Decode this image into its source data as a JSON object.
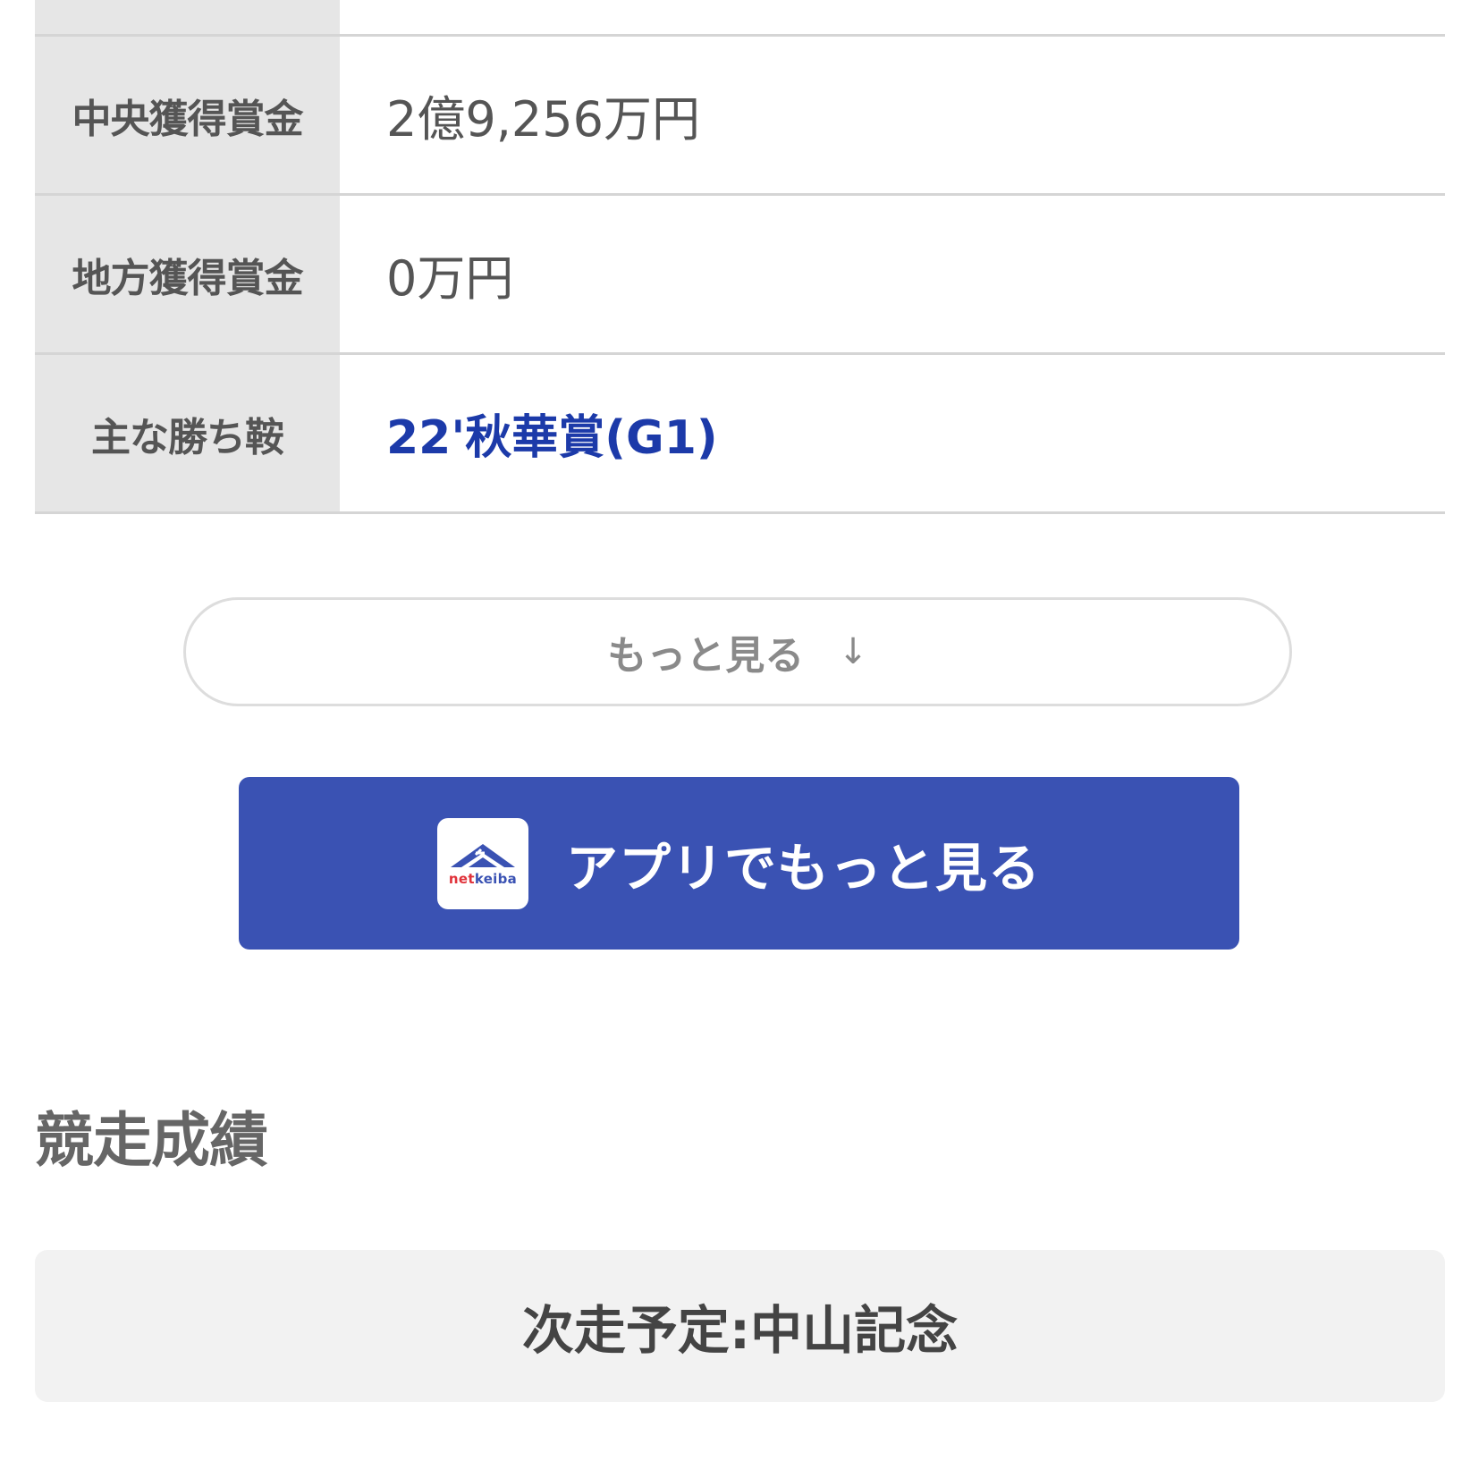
{
  "profile": {
    "rows": [
      {
        "label": "中央獲得賞金",
        "value": "2億9,256万円"
      },
      {
        "label": "地方獲得賞金",
        "value": "0万円"
      },
      {
        "label": "主な勝ち鞍",
        "value": "22'秋華賞(G1)"
      }
    ]
  },
  "more_button": {
    "label": "もっと見る",
    "icon": "arrow-down-icon",
    "arrow": "↓"
  },
  "app_button": {
    "label": "アプリでもっと見る",
    "logo": {
      "net": "net",
      "keiba": "keiba"
    },
    "colors": {
      "background": "#3a52b3",
      "logo_red": "#e0323a"
    }
  },
  "race_results": {
    "title": "競走成績"
  },
  "next_race": {
    "text": "次走予定:中山記念"
  },
  "colors": {
    "link": "#1c3aa9",
    "header_cell": "#e6e6e6",
    "border": "#d5d5d5"
  }
}
